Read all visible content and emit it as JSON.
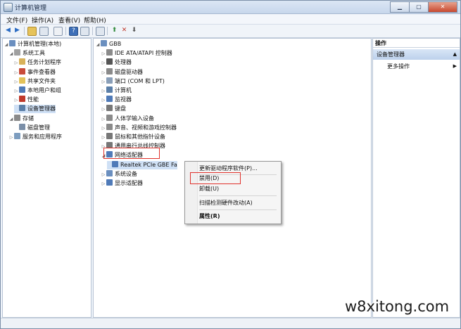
{
  "window": {
    "title": "计算机管理"
  },
  "menu": [
    "文件(F)",
    "操作(A)",
    "查看(V)",
    "帮助(H)"
  ],
  "left_tree": [
    {
      "label": "计算机管理(本地)",
      "indent": 0,
      "tri": "◢",
      "icon": "computer-manage-icon",
      "color": "#6b8fbf"
    },
    {
      "label": "系统工具",
      "indent": 1,
      "tri": "◢",
      "icon": "tools-icon",
      "color": "#a0a0a0"
    },
    {
      "label": "任务计划程序",
      "indent": 2,
      "tri": "▷",
      "icon": "clock-icon",
      "color": "#d8b25a"
    },
    {
      "label": "事件查看器",
      "indent": 2,
      "tri": "▷",
      "icon": "event-viewer-icon",
      "color": "#c94b3a"
    },
    {
      "label": "共享文件夹",
      "indent": 2,
      "tri": "▷",
      "icon": "shared-folder-icon",
      "color": "#e3c25a"
    },
    {
      "label": "本地用户和组",
      "indent": 2,
      "tri": "▷",
      "icon": "users-icon",
      "color": "#4f7ab8"
    },
    {
      "label": "性能",
      "indent": 2,
      "tri": "▷",
      "icon": "performance-icon",
      "color": "#c0392b"
    },
    {
      "label": "设备管理器",
      "indent": 2,
      "tri": "",
      "icon": "device-manager-icon",
      "color": "#5b7fa8"
    },
    {
      "label": "存储",
      "indent": 1,
      "tri": "◢",
      "icon": "storage-icon",
      "color": "#8a8a8a"
    },
    {
      "label": "磁盘管理",
      "indent": 2,
      "tri": "",
      "icon": "disk-icon",
      "color": "#7b8fa8"
    },
    {
      "label": "服务和应用程序",
      "indent": 1,
      "tri": "▷",
      "icon": "services-icon",
      "color": "#7d9dbf"
    }
  ],
  "device_tree": [
    {
      "label": "GBB",
      "indent": 0,
      "tri": "◢",
      "icon": "computer-icon",
      "color": "#6b8fbf"
    },
    {
      "label": "IDE ATA/ATAPI 控制器",
      "indent": 1,
      "tri": "▷",
      "icon": "ide-controller-icon",
      "color": "#8a8a8a"
    },
    {
      "label": "处理器",
      "indent": 1,
      "tri": "▷",
      "icon": "processor-icon",
      "color": "#555555"
    },
    {
      "label": "磁盘驱动器",
      "indent": 1,
      "tri": "▷",
      "icon": "disk-drive-icon",
      "color": "#8a8a8a"
    },
    {
      "label": "端口 (COM 和 LPT)",
      "indent": 1,
      "tri": "▷",
      "icon": "port-icon",
      "color": "#8a9fb8"
    },
    {
      "label": "计算机",
      "indent": 1,
      "tri": "▷",
      "icon": "computer-icon",
      "color": "#5b7fa8"
    },
    {
      "label": "监视器",
      "indent": 1,
      "tri": "▷",
      "icon": "monitor-icon",
      "color": "#4f7ab8"
    },
    {
      "label": "键盘",
      "indent": 1,
      "tri": "▷",
      "icon": "keyboard-icon",
      "color": "#777777"
    },
    {
      "label": "人体学输入设备",
      "indent": 1,
      "tri": "▷",
      "icon": "hid-icon",
      "color": "#8a8a8a"
    },
    {
      "label": "声音、视频和游戏控制器",
      "indent": 1,
      "tri": "▷",
      "icon": "sound-icon",
      "color": "#8a8a8a"
    },
    {
      "label": "鼠标和其他指针设备",
      "indent": 1,
      "tri": "▷",
      "icon": "mouse-icon",
      "color": "#777777"
    },
    {
      "label": "通用串行总线控制器",
      "indent": 1,
      "tri": "▷",
      "icon": "usb-icon",
      "color": "#777777"
    },
    {
      "label": "网络适配器",
      "indent": 1,
      "tri": "◢",
      "icon": "network-adapter-icon",
      "color": "#4f7ab8"
    },
    {
      "label": "Realtek PCIe GBE Fa",
      "indent": 2,
      "tri": "",
      "icon": "network-card-icon",
      "color": "#4f7ab8"
    },
    {
      "label": "系统设备",
      "indent": 1,
      "tri": "▷",
      "icon": "system-device-icon",
      "color": "#6b8fbf"
    },
    {
      "label": "显示适配器",
      "indent": 1,
      "tri": "▷",
      "icon": "display-adapter-icon",
      "color": "#4f7ab8"
    }
  ],
  "context_menu": [
    {
      "label": "更新驱动程序软件(P)...",
      "bold": false
    },
    {
      "label": "禁用(D)",
      "bold": false
    },
    {
      "label": "卸载(U)",
      "bold": false
    },
    {
      "label": "扫描检测硬件改动(A)",
      "bold": false
    },
    {
      "label": "属性(R)",
      "bold": true
    }
  ],
  "actions": {
    "header": "操作",
    "section": "设备管理器",
    "more": "更多操作"
  },
  "watermark": "w8xitong.com",
  "colors": {
    "highlight_box": "#e0312b",
    "selection": "#cfe0f5"
  }
}
